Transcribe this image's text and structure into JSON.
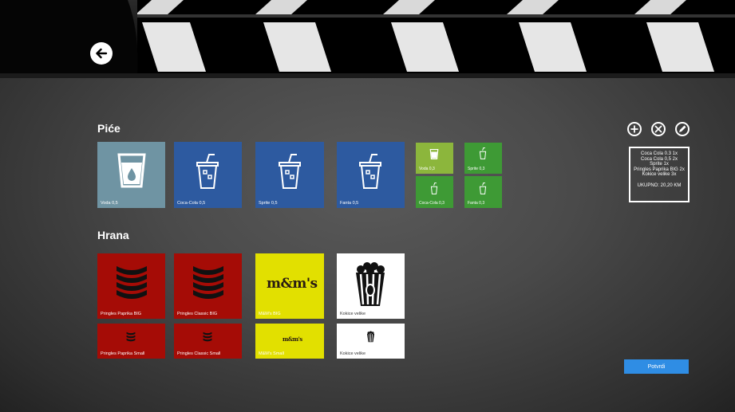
{
  "sections": {
    "drinks_title": "Piće",
    "food_title": "Hrana"
  },
  "drinks": [
    {
      "label": "Voda 0,5",
      "icon": "water-glass-icon",
      "color": "#6f94a3"
    },
    {
      "label": "Coca-Cola 0,5",
      "icon": "soda-cup-icon",
      "color": "#2d5aa0"
    },
    {
      "label": "Sprite 0,5",
      "icon": "soda-cup-icon",
      "color": "#2d5aa0"
    },
    {
      "label": "Fanta 0,5",
      "icon": "soda-cup-icon",
      "color": "#2d5aa0"
    }
  ],
  "drinks_small": [
    {
      "label": "Voda 0,3",
      "icon": "water-glass-icon",
      "color": "#8cb63c"
    },
    {
      "label": "Sprite 0,3",
      "icon": "soda-cup-icon",
      "color": "#3e9a35"
    },
    {
      "label": "Coca-Cola 0,3",
      "icon": "soda-cup-icon",
      "color": "#3e9a35"
    },
    {
      "label": "Fanta 0,3",
      "icon": "soda-cup-icon",
      "color": "#3e9a35"
    }
  ],
  "food": [
    {
      "label": "Pringles Paprika BIG",
      "icon": "pringles-chips-icon",
      "color": "#a50c06"
    },
    {
      "label": "Pringles Classic BIG",
      "icon": "pringles-chips-icon",
      "color": "#a50c06"
    },
    {
      "label": "M&M's BIG",
      "icon": "mms-logo",
      "logo_text": "m&m's",
      "color": "#e2e000"
    },
    {
      "label": "Kokice velike",
      "icon": "popcorn-icon",
      "color": "#ffffff"
    }
  ],
  "food_small": [
    {
      "label": "Pringles Paprika Small",
      "icon": "pringles-chips-icon",
      "color": "#a50c06"
    },
    {
      "label": "Pringles Classic Small",
      "icon": "pringles-chips-icon",
      "color": "#a50c06"
    },
    {
      "label": "M&M's Small",
      "icon": "mms-logo",
      "logo_text": "m&m's",
      "color": "#e2e000"
    },
    {
      "label": "Kokice velike",
      "icon": "popcorn-icon",
      "color": "#ffffff"
    }
  ],
  "order": {
    "lines": [
      "Coca Cola 0.3 1x",
      "Coca Cola 0,5 2x",
      "Sprite 1x",
      "Pringles Paprika BIG 2x",
      "Kokice velike 3x"
    ],
    "total": "UKUPNO: 20,20 KM"
  },
  "actions": {
    "add_icon": "plus-icon",
    "remove_icon": "close-icon",
    "edit_icon": "pencil-icon",
    "confirm_label": "Potvrdi"
  },
  "colors": {
    "accent": "#2f8de4",
    "drink_blue": "#2d5aa0",
    "food_red": "#a50c06"
  }
}
